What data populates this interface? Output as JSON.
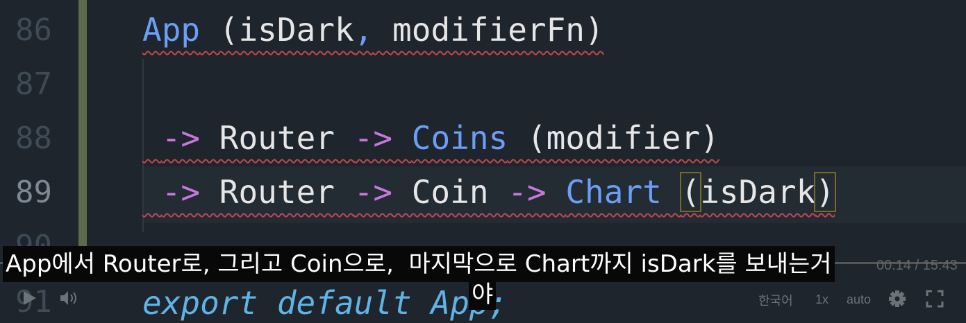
{
  "editor": {
    "line_numbers": [
      "86",
      "87",
      "88",
      "89",
      "90",
      "91"
    ],
    "lines": {
      "l86": {
        "a": "App",
        "b": " (isDark",
        "c": ",",
        "d": " modifierFn)"
      },
      "l88": {
        "a": " ",
        "op1": "->",
        "b": " Router ",
        "op2": "->",
        "c": " ",
        "d": "Coins",
        "e": " (modifier)"
      },
      "l89": {
        "a": " ",
        "op1": "->",
        "b": " Router ",
        "op2": "->",
        "c": " Coin ",
        "op3": "->",
        "d": " ",
        "e": "Chart",
        "f": " ",
        "g": "(",
        "h": "isDark",
        "i": ")"
      },
      "l91": {
        "a": "export default ",
        "b": "App;"
      }
    }
  },
  "subtitle": {
    "line1": "App에서 Router로, 그리고 Coin으로,  마지막으로 Chart까지 isDark를 보내는거",
    "line2": "야"
  },
  "player": {
    "time": "00:14 / 15:43",
    "language": "한국어",
    "speed": "1x",
    "quality": "auto",
    "icons": [
      "play-icon",
      "volume-icon",
      "gear-icon",
      "fullscreen-icon"
    ]
  }
}
